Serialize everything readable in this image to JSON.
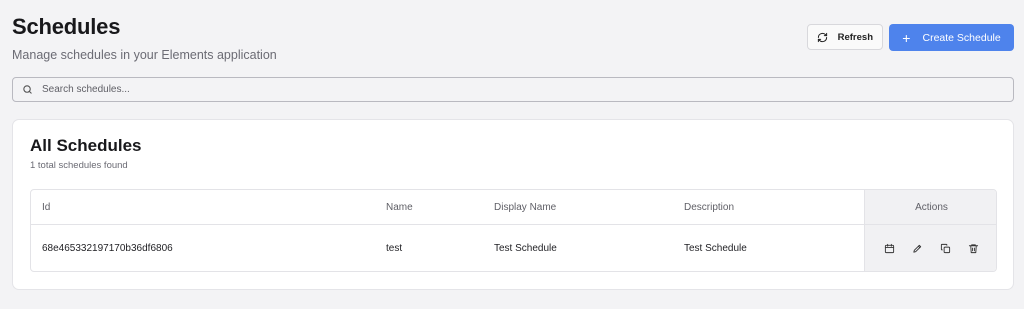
{
  "header": {
    "title": "Schedules",
    "subtitle": "Manage schedules in your Elements application"
  },
  "toolbar": {
    "refresh_label": "Refresh",
    "create_label": "Create Schedule",
    "create_icon": "+"
  },
  "search": {
    "placeholder": "Search schedules...",
    "value": ""
  },
  "card": {
    "title": "All Schedules",
    "count_text": "1 total schedules found"
  },
  "table": {
    "columns": [
      "Id",
      "Name",
      "Display Name",
      "Description",
      "Actions"
    ],
    "rows": [
      {
        "id": "68e465332197170b36df6806",
        "name": "test",
        "display_name": "Test Schedule",
        "description": "Test Schedule"
      }
    ],
    "row_actions": [
      "calendar-icon",
      "edit-pencil-icon",
      "copy-icon",
      "delete-trash-icon"
    ]
  },
  "colors": {
    "accent": "#4e83ec",
    "background": "#f3f3f5",
    "card": "#ffffff",
    "actions_column": "#f1f1f3"
  }
}
